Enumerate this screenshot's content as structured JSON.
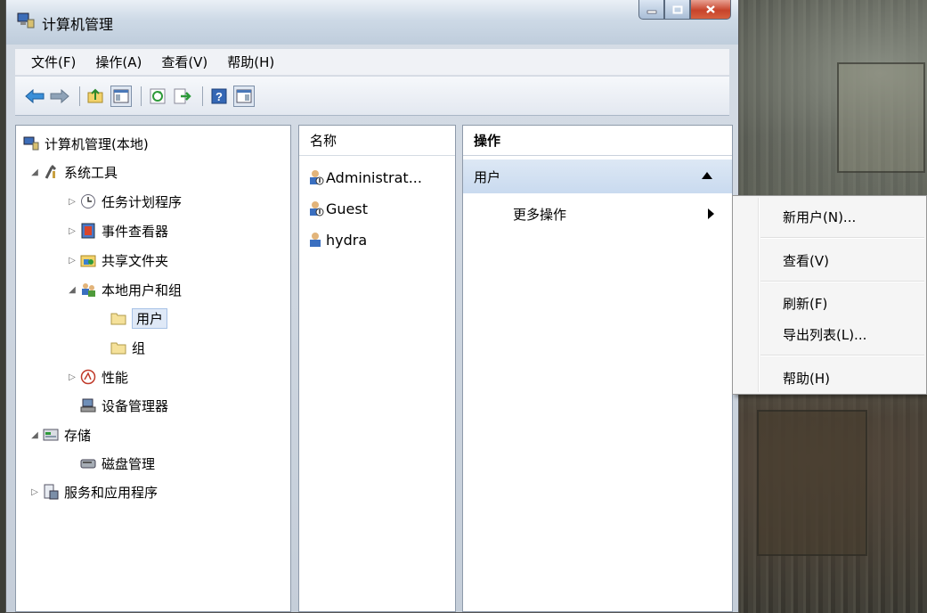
{
  "window": {
    "title": "计算机管理"
  },
  "menu": [
    "文件(F)",
    "操作(A)",
    "查看(V)",
    "帮助(H)"
  ],
  "tree": {
    "root": "计算机管理(本地)",
    "system_tools": "系统工具",
    "task_scheduler": "任务计划程序",
    "event_viewer": "事件查看器",
    "shared_folders": "共享文件夹",
    "local_users_groups": "本地用户和组",
    "users": "用户",
    "groups": "组",
    "performance": "性能",
    "device_manager": "设备管理器",
    "storage": "存储",
    "disk_management": "磁盘管理",
    "services_apps": "服务和应用程序"
  },
  "list": {
    "column_header": "名称",
    "items": [
      "Administrat...",
      "Guest",
      "hydra"
    ]
  },
  "actions": {
    "header": "操作",
    "section": "用户",
    "more": "更多操作"
  },
  "context_menu": [
    "新用户(N)...",
    "查看(V)",
    "刷新(F)",
    "导出列表(L)...",
    "帮助(H)"
  ],
  "colors": {
    "selection": "#dfe9f7",
    "action_section": "#c9daef"
  }
}
